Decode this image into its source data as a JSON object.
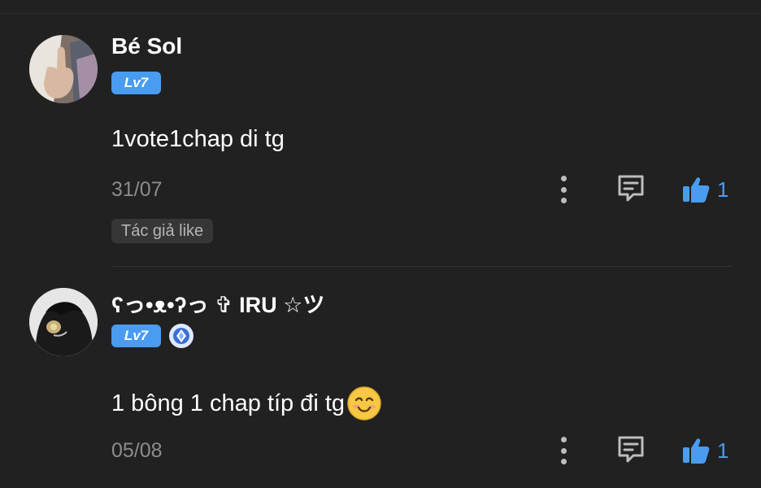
{
  "comments": [
    {
      "username": "Bé Sol",
      "level": "Lv7",
      "text": "1vote1chap di tg",
      "date": "31/07",
      "likes": "1",
      "author_like_tag": "Tác giả like"
    },
    {
      "username": "ʕっ•ᴥ•ʔっ ✞ IRU ☆ツ",
      "level": "Lv7",
      "text": "1 bông 1 chap típ đi tg",
      "date": "05/08",
      "likes": "1"
    }
  ],
  "icons": {
    "more": "more-vertical-icon",
    "reply": "comment-icon",
    "like": "thumbs-up-icon",
    "gem": "diamond-badge-icon",
    "emoji": "smiling-face-emoji"
  },
  "colors": {
    "background": "#212121",
    "accent": "#4a9cf0",
    "muted_text": "#8c8c8c"
  }
}
